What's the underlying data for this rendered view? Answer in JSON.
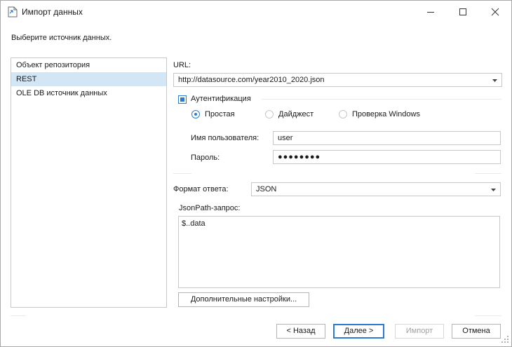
{
  "window": {
    "title": "Импорт данных",
    "app_icon": "document-import-icon",
    "controls": [
      "minimize-icon",
      "maximize-icon",
      "close-icon"
    ]
  },
  "prompt": "Выберите источник данных.",
  "sources": [
    {
      "label": "Объект репозитория",
      "selected": false
    },
    {
      "label": "REST",
      "selected": true
    },
    {
      "label": "OLE DB источник данных",
      "selected": false
    }
  ],
  "form": {
    "url_label": "URL:",
    "url_value": "http://datasource.com/year2010_2020.json",
    "auth_label": "Аутентификация",
    "auth_checked": true,
    "auth_types": [
      {
        "label": "Простая",
        "selected": true
      },
      {
        "label": "Дайджест",
        "selected": false
      },
      {
        "label": "Проверка Windows",
        "selected": false
      }
    ],
    "username_label": "Имя пользователя:",
    "username_value": "user",
    "password_label": "Пароль:",
    "password_value": "●●●●●●●●",
    "format_label": "Формат ответа:",
    "format_value": "JSON",
    "jsonpath_label": "JsonPath-запрос:",
    "jsonpath_value": "$..data",
    "advanced_button": "Дополнительные настройки..."
  },
  "footer": {
    "back": "< Назад",
    "next": "Далее >",
    "import": "Импорт",
    "cancel": "Отмена"
  },
  "colors": {
    "accent": "#2d7bd0",
    "selection": "#d3e6f5",
    "border": "#c8c8c8"
  }
}
